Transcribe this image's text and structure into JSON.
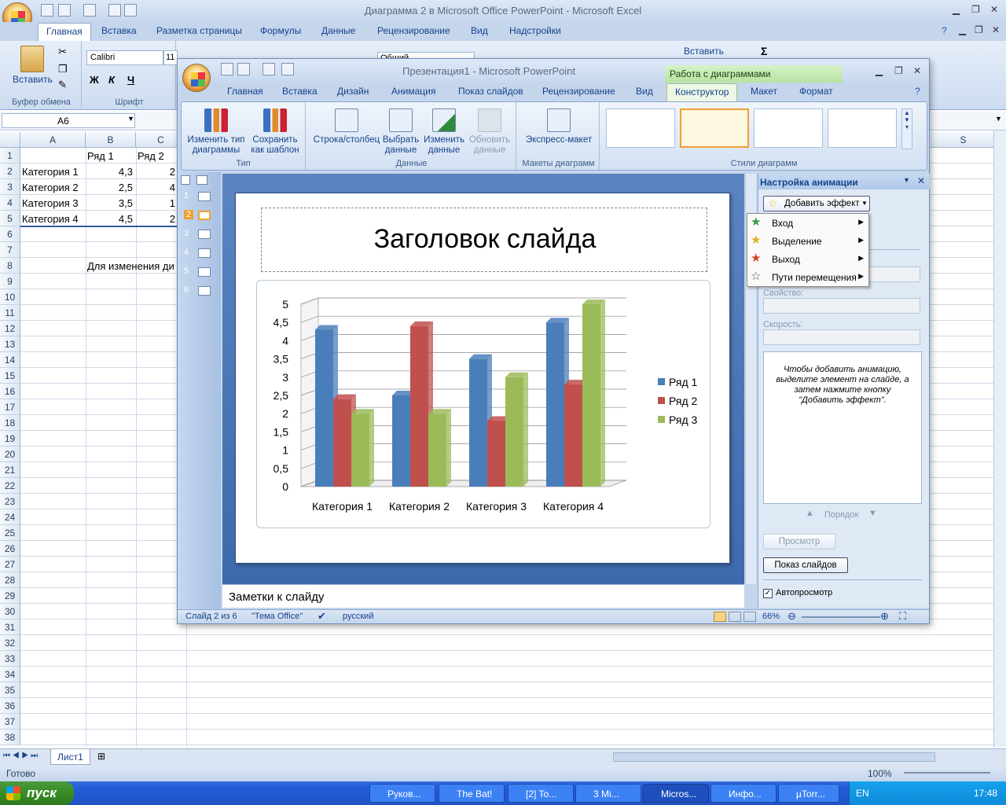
{
  "excel": {
    "title": "Диаграмма 2 в Microsoft Office PowerPoint - Microsoft Excel",
    "tabs": [
      "Главная",
      "Вставка",
      "Разметка страницы",
      "Формулы",
      "Данные",
      "Рецензирование",
      "Вид",
      "Надстройки"
    ],
    "ribbon": {
      "paste_label": "Вставить",
      "clipboard_group": "Буфер обмена",
      "font_group": "Шрифт",
      "font_name": "Calibri",
      "font_size": "11",
      "number_format": "Общий",
      "insert_label": "Вставить",
      "bold": "Ж",
      "italic": "К",
      "underline": "Ч",
      "sigma": "Σ"
    },
    "name_box": "A6",
    "columns": [
      "A",
      "B",
      "C",
      "S"
    ],
    "rows": [
      "1",
      "2",
      "3",
      "4",
      "5",
      "6",
      "7",
      "8",
      "9",
      "10",
      "11",
      "12",
      "13",
      "14",
      "15",
      "16",
      "17",
      "18",
      "19",
      "20",
      "21",
      "22",
      "23",
      "24",
      "25",
      "26",
      "27",
      "28",
      "29",
      "30",
      "31",
      "32",
      "33",
      "34",
      "35",
      "36",
      "37",
      "38"
    ],
    "cells": {
      "b1": "Ряд 1",
      "c1": "Ряд 2",
      "a2": "Категория 1",
      "b2": "4,3",
      "c2": "2",
      "a3": "Категория 2",
      "b3": "2,5",
      "c3": "4",
      "a4": "Категория 3",
      "b4": "3,5",
      "c4": "1",
      "a5": "Категория 4",
      "b5": "4,5",
      "c5": "2",
      "b8": "Для изменения ди"
    },
    "sheet_tab": "Лист1",
    "status": "Готово",
    "zoom": "100%"
  },
  "ppt": {
    "title": "Презентация1 - Microsoft PowerPoint",
    "context_header": "Работа с диаграммами",
    "tabs": [
      "Главная",
      "Вставка",
      "Дизайн",
      "Анимация",
      "Показ слайдов",
      "Рецензирование",
      "Вид",
      "Конструктор",
      "Макет",
      "Формат"
    ],
    "ribbon": {
      "change_type_1": "Изменить тип",
      "change_type_2": "диаграммы",
      "save_tpl_1": "Сохранить",
      "save_tpl_2": "как шаблон",
      "group_type": "Тип",
      "row_col": "Строка/столбец",
      "select_1": "Выбрать",
      "select_2": "данные",
      "edit_1": "Изменить",
      "edit_2": "данные",
      "refresh_1": "Обновить",
      "refresh_2": "данные",
      "group_data": "Данные",
      "quick_layout": "Экспресс-макет",
      "group_layouts": "Макеты диаграмм",
      "group_styles": "Стили диаграмм"
    },
    "slides": [
      "1",
      "2",
      "3",
      "4",
      "5",
      "6"
    ],
    "slide_title": "Заголовок слайда",
    "notes": "Заметки к слайду",
    "status": {
      "slide": "Слайд 2 из 6",
      "theme": "\"Тема Office\"",
      "lang": "русский",
      "zoom": "66%"
    },
    "pane": {
      "title": "Настройка анимации",
      "add_effect": "Добавить эффект",
      "property": "Свойство:",
      "speed": "Скорость:",
      "hint": "Чтобы добавить анимацию, выделите элемент на слайде, а затем нажмите кнопку \"Добавить эффект\".",
      "order": "Порядок",
      "preview": "Просмотр",
      "slideshow": "Показ слайдов",
      "autopreview": "Автопросмотр"
    },
    "menu": [
      "Вход",
      "Выделение",
      "Выход",
      "Пути перемещения"
    ]
  },
  "taskbar": {
    "start": "пуск",
    "buttons": [
      "Руков...",
      "The Bat!",
      "[2] To...",
      "3 Mi...",
      "Micros...",
      "Инфо...",
      "µTorr..."
    ],
    "lang": "EN",
    "clock": "17:48"
  },
  "chart_data": {
    "type": "bar",
    "categories": [
      "Категория 1",
      "Категория 2",
      "Категория 3",
      "Категория 4"
    ],
    "series": [
      {
        "name": "Ряд 1",
        "values": [
          4.3,
          2.5,
          3.5,
          4.5
        ],
        "color": "#4a7ebb"
      },
      {
        "name": "Ряд 2",
        "values": [
          2.4,
          4.4,
          1.8,
          2.8
        ],
        "color": "#c0504d"
      },
      {
        "name": "Ряд 3",
        "values": [
          2.0,
          2.0,
          3.0,
          5.0
        ],
        "color": "#9bbb59"
      }
    ],
    "yticks": [
      "0",
      "0,5",
      "1",
      "1,5",
      "2",
      "2,5",
      "3",
      "3,5",
      "4",
      "4,5",
      "5"
    ],
    "ylim": [
      0,
      5
    ],
    "legend": "right",
    "grid": true
  }
}
